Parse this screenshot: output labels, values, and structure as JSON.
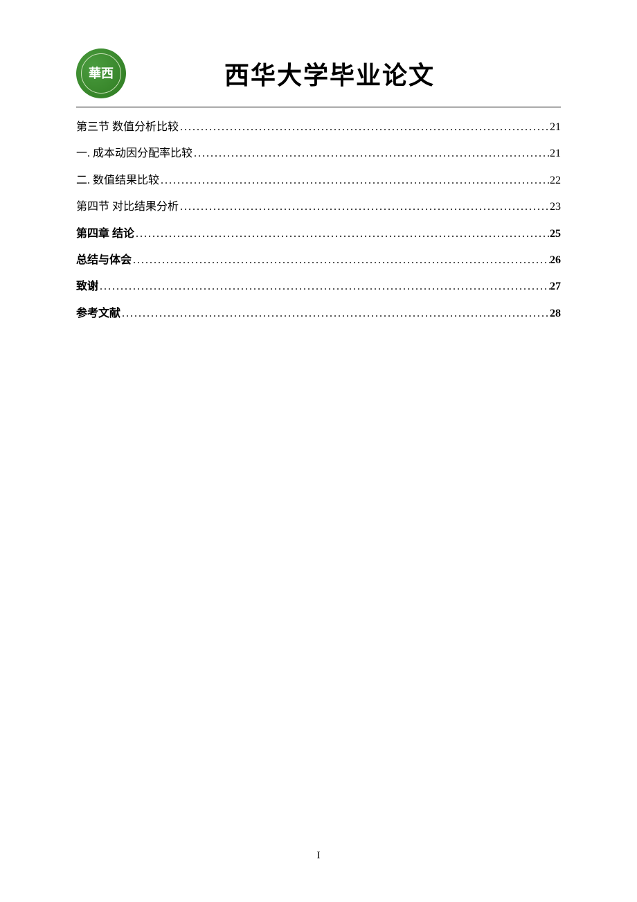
{
  "header": {
    "logo_text": "華西",
    "title": "西华大学毕业论文"
  },
  "toc": {
    "entries": [
      {
        "label": "第三节 数值分析比较",
        "page": "21",
        "bold": false
      },
      {
        "label": "一. 成本动因分配率比较",
        "page": "21",
        "bold": false
      },
      {
        "label": "二. 数值结果比较",
        "page": "22",
        "bold": false
      },
      {
        "label": "第四节 对比结果分析",
        "page": "23",
        "bold": false
      },
      {
        "label": "第四章 结论",
        "page": "25",
        "bold": true
      },
      {
        "label": "总结与体会",
        "page": "26",
        "bold": true
      },
      {
        "label": "致谢",
        "page": "27",
        "bold": true
      },
      {
        "label": "参考文献",
        "page": "28",
        "bold": true
      }
    ]
  },
  "footer": {
    "page_number": "I"
  }
}
